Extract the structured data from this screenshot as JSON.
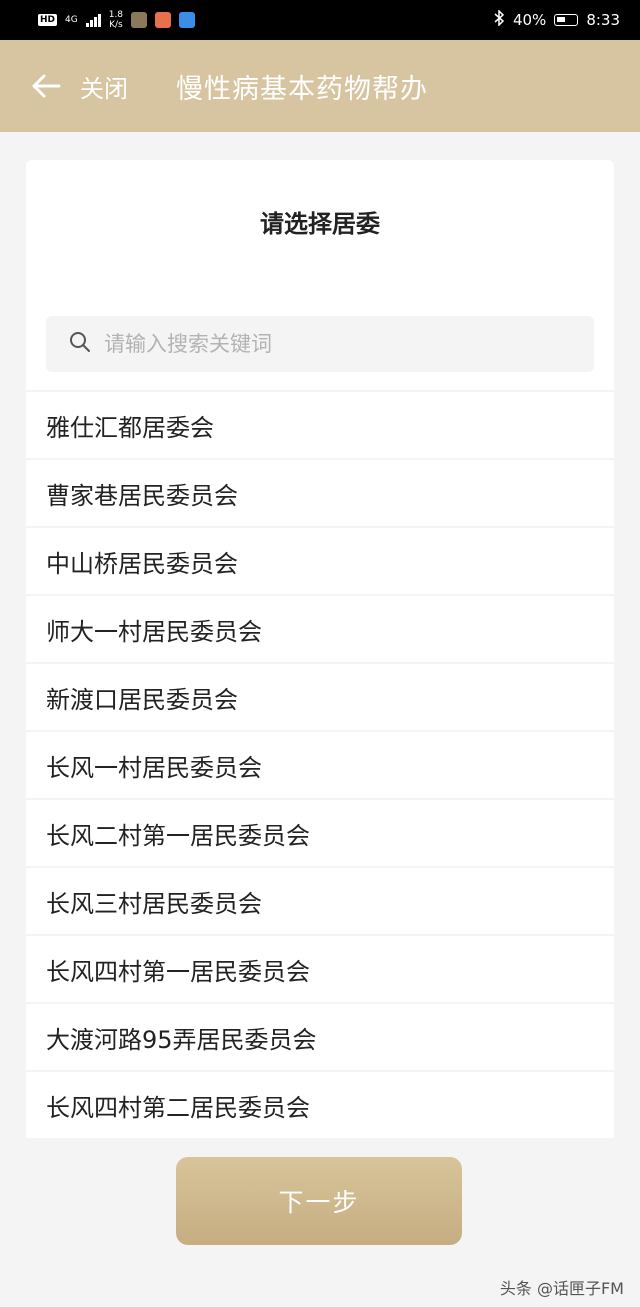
{
  "status_bar": {
    "hd": "HD",
    "network_type": "4G",
    "speed": "1.8",
    "speed_unit": "K/s",
    "battery": "40%",
    "time": "8:33"
  },
  "nav": {
    "close_label": "关闭",
    "title": "慢性病基本药物帮办"
  },
  "card": {
    "title": "请选择居委",
    "search_placeholder": "请输入搜索关键词"
  },
  "list": {
    "items": [
      "雅仕汇都居委会",
      "曹家巷居民委员会",
      "中山桥居民委员会",
      "师大一村居民委员会",
      "新渡口居民委员会",
      "长风一村居民委员会",
      "长风二村第一居民委员会",
      "长风三村居民委员会",
      "长风四村第一居民委员会",
      "大渡河路95弄居民委员会",
      "长风四村第二居民委员会"
    ]
  },
  "next_button": "下一步",
  "watermark": "头条 @话匣子FM",
  "colors": {
    "header_bg": "#d6c5a0",
    "button_bg": "#cbb38a",
    "page_bg": "#f4f4f4"
  }
}
